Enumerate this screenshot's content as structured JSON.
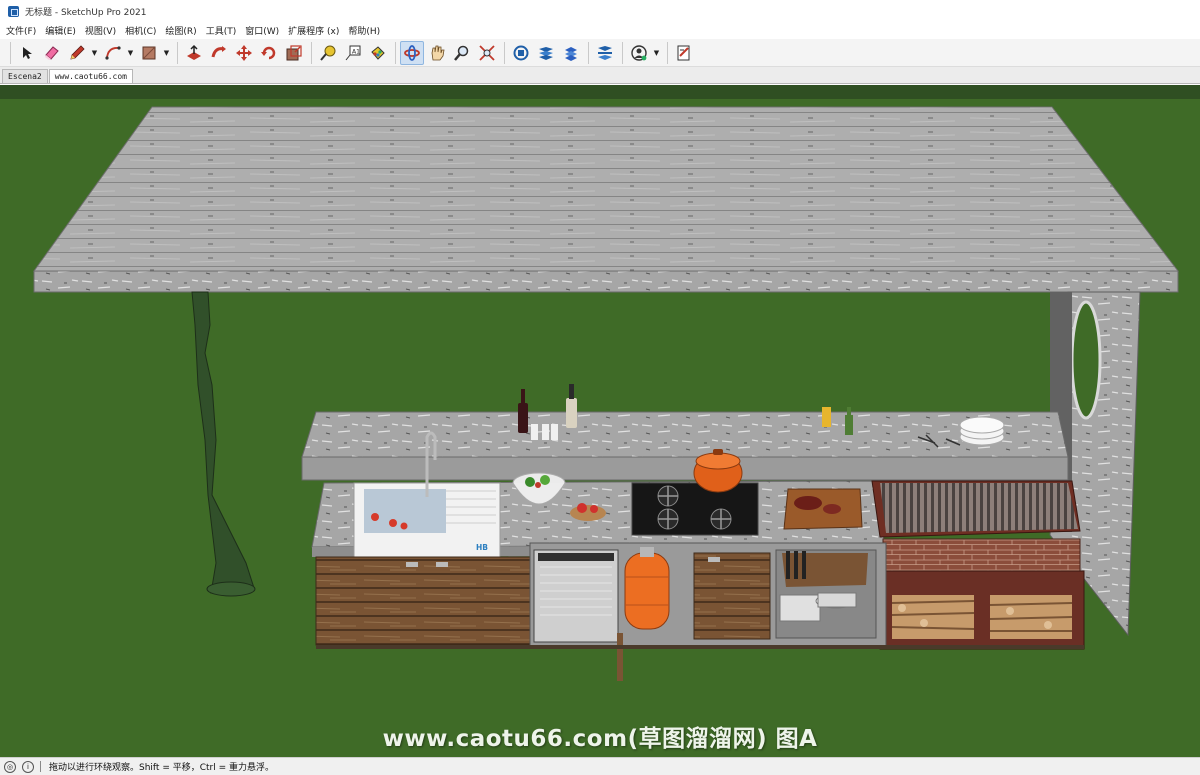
{
  "window": {
    "title": "无标题 - SketchUp Pro 2021"
  },
  "menu": [
    "文件(F)",
    "编辑(E)",
    "视图(V)",
    "相机(C)",
    "绘图(R)",
    "工具(T)",
    "窗口(W)",
    "扩展程序 (x)",
    "帮助(H)"
  ],
  "toolbar": {
    "icons": [
      "select-icon",
      "eraser-icon",
      "pencil-icon",
      "arc-icon",
      "rectangle-icon",
      "push-pull-icon",
      "follow-me-icon",
      "move-icon",
      "rotate-icon",
      "scale-icon",
      "tape-measure-icon",
      "text-icon",
      "paint-bucket-icon",
      "orbit-icon",
      "pan-icon",
      "zoom-icon",
      "zoom-extents-icon",
      "warehouse-icon",
      "extension-warehouse-icon",
      "layout-icon",
      "style-builder-icon",
      "account-icon",
      "send-to-layout-icon"
    ],
    "active": "orbit-icon"
  },
  "scenes": {
    "tabs": [
      "Escena2",
      "www.caotu66.com"
    ],
    "active_index": 1
  },
  "viewport": {
    "sink_logo": "HB",
    "watermark": "www.caotu66.com(草图溜溜网) 图A",
    "colors": {
      "ground": "#3f6b27",
      "counter": "#9d9d9d",
      "wood": "#7a5434",
      "pole": "#31502a",
      "pot": "#e0601a",
      "gas_tank": "#ec6e22"
    }
  },
  "status": {
    "text": "拖动以进行环绕观察。Shift = 平移，Ctrl = 重力悬浮。"
  }
}
